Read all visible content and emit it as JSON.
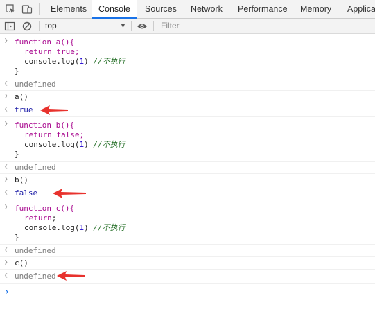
{
  "tabs": [
    "Elements",
    "Console",
    "Sources",
    "Network",
    "Performance",
    "Memory",
    "Applicat"
  ],
  "active_tab": "Console",
  "toolbar": {
    "context": "top",
    "filter_placeholder": "Filter"
  },
  "console": {
    "func_a": {
      "sig": "function a(){",
      "ret_kw": "return",
      "ret_val": " true;",
      "log_pre": "console.log(",
      "log_num": "1",
      "log_post": ")",
      "comment": "//不执行",
      "close": "}"
    },
    "out_a": "undefined",
    "call_a": "a()",
    "res_a": "true",
    "func_b": {
      "sig": "function b(){",
      "ret_kw": "return",
      "ret_val": " false;",
      "log_pre": "console.log(",
      "log_num": "1",
      "log_post": ")",
      "comment": "//不执行",
      "close": "}"
    },
    "out_b": "undefined",
    "call_b": "b()",
    "res_b": "false",
    "func_c": {
      "sig": "function c(){",
      "ret_kw": "return",
      "ret_val": ";",
      "log_pre": "console.log(",
      "log_num": "1",
      "log_post": ")",
      "comment": "//不执行",
      "close": "}"
    },
    "out_c": "undefined",
    "call_c": "c()",
    "res_c": "undefined",
    "prompt": "›"
  },
  "colors": {
    "arrow": "#e8322d",
    "prompt": "#1a73e8",
    "active_tab_underline": "#1a73e8"
  }
}
